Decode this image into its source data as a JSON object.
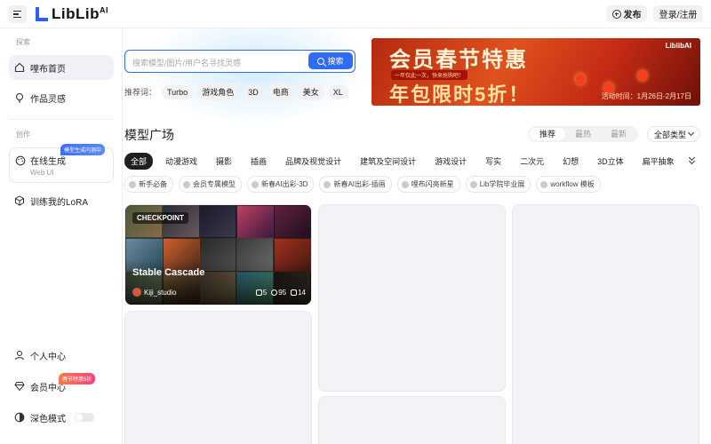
{
  "header": {
    "logo_text": "LibLib",
    "logo_sup": "AI",
    "publish_label": "发布",
    "login_label": "登录/注册"
  },
  "sidebar": {
    "section_explore": "探索",
    "home_label": "哩布首页",
    "inspiration_label": "作品灵感",
    "section_create": "创作",
    "online_gen_label": "在线生成",
    "online_gen_sub": "Web UI",
    "online_gen_badge": "模型生成内测中",
    "train_lora_label": "训练我的LoRA",
    "personal_center_label": "个人中心",
    "member_center_label": "会员中心",
    "member_badge": "春节特惠5折",
    "dark_mode_label": "深色模式"
  },
  "search": {
    "placeholder": "搜索模型/图片/用户名寻找灵感",
    "button_label": "搜索",
    "hot_label": "推荐词：",
    "hot_tags": [
      "Turbo",
      "游戏角色",
      "3D",
      "电商",
      "美女",
      "XL"
    ]
  },
  "banner": {
    "line1": "会员春节特惠",
    "line2": "一年仅此一次，快来抢购吧！",
    "line3": "年包限时5折！",
    "brand": "LiblibAI",
    "date": "活动时间：1月26日-2月17日"
  },
  "plaza": {
    "title": "模型广场",
    "sort_tabs": [
      "推荐",
      "最热",
      "最新"
    ],
    "type_select": "全部类型",
    "categories": [
      "全部",
      "动漫游戏",
      "摄影",
      "插画",
      "品牌及视觉设计",
      "建筑及空间设计",
      "游戏设计",
      "写实",
      "二次元",
      "幻想",
      "3D立体",
      "扁平抽象"
    ],
    "subtags": [
      "新手必备",
      "会员专属模型",
      "新春AI出彩-3D",
      "新春AI出彩-插画",
      "哩布闪亮新星",
      "Lib学院毕业展",
      "workflow 模板"
    ]
  },
  "featured_card": {
    "type_badge": "CHECKPOINT",
    "name": "Stable Cascade",
    "author": "Kiji_studio",
    "runs": "5",
    "downloads": "95",
    "likes": "14"
  },
  "colors": {
    "accent": "#2f6cf5",
    "brand": "#2f5cff",
    "banner_red": "#c22a14"
  }
}
